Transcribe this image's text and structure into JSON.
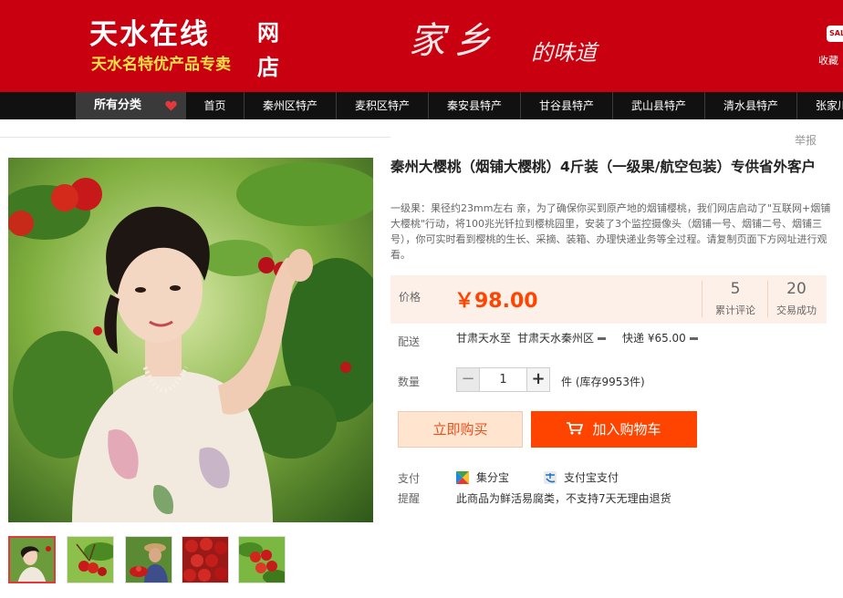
{
  "header": {
    "logo_title": "天水在线",
    "logo_wang": "网",
    "logo_dian": "店",
    "logo_subtitle": "天水名特优产品专卖",
    "slogan_big": "家乡",
    "slogan_small": "的味道",
    "sale_badge": "SALE",
    "favorite_label": "收藏"
  },
  "nav": {
    "all_categories": "所有分类",
    "items": [
      "首页",
      "秦州区特产",
      "麦积区特产",
      "秦安县特产",
      "甘谷县特产",
      "武山县特产",
      "清水县特产",
      "张家川"
    ]
  },
  "report_label": "举报",
  "product": {
    "title": "秦州大樱桃（烟铺大樱桃）4斤装（一级果/航空包装）专供省外客户",
    "description": "一级果：果径约23mm左右 亲，为了确保你买到原产地的烟铺樱桃，我们网店启动了\"互联网+烟铺大樱桃\"行动，将100兆光钎拉到樱桃园里，安装了3个监控摄像头（烟铺一号、烟铺二号、烟铺三号），你可实时看到樱桃的生长、采摘、装箱、办理快递业务等全过程。请复制页面下方网址进行观看。",
    "price_label": "价格",
    "price": "￥98.00",
    "reviews_count": "5",
    "reviews_label": "累计评论",
    "deals_count": "20",
    "deals_label": "交易成功"
  },
  "delivery": {
    "label": "配送",
    "origin": "甘肃天水至",
    "destination": "甘肃天水秦州区",
    "method": "快递 ¥65.00"
  },
  "quantity": {
    "label": "数量",
    "minus": "−",
    "value": "1",
    "plus": "+",
    "stock": "件 (库存9953件)"
  },
  "buttons": {
    "buy_now": "立即购买",
    "add_to_cart": "加入购物车"
  },
  "payment": {
    "label": "支付",
    "option1": "集分宝",
    "option2": "支付宝支付"
  },
  "notice": {
    "label": "提醒",
    "text": "此商品为鲜活易腐类，不支持7天无理由退货"
  },
  "colors": {
    "header_red": "#c8000f",
    "price_orange": "#ff4400",
    "nav_black": "#111111"
  },
  "icons": [
    "heart-icon",
    "cart-icon",
    "jifenbao-icon",
    "alipay-icon"
  ]
}
